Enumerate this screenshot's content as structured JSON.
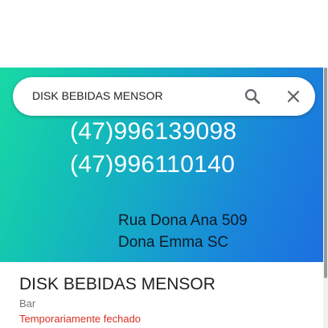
{
  "search": {
    "query": "DISK BEBIDAS MENSOR"
  },
  "icons": {
    "search": "search-icon",
    "close": "close-icon"
  },
  "hero_image": {
    "phone_1": "(47)996139098",
    "phone_2": "(47)996110140",
    "address_line_1": "Rua Dona Ana 509",
    "address_line_2": "Dona Emma SC"
  },
  "place": {
    "name": "DISK BEBIDAS MENSOR",
    "category": "Bar",
    "status": "Temporariamente fechado",
    "status_color": "#d93025"
  }
}
